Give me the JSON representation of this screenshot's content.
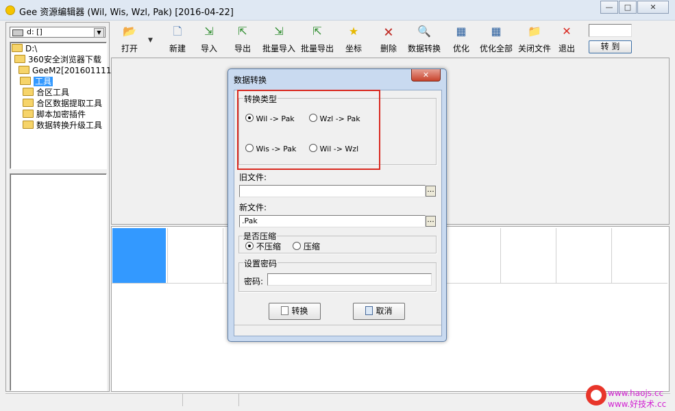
{
  "window": {
    "title": "Gee 资源编辑器 (Wil, Wis, Wzl, Pak) [2016-04-22]",
    "min": "—",
    "max": "□",
    "close": "✕"
  },
  "drive": {
    "value": "d: []"
  },
  "tree": {
    "items": [
      "D:\\",
      "360安全浏览器下载",
      "GeeM2[201601111]",
      "工具",
      "合区工具",
      "合区数据提取工具",
      "脚本加密插件",
      "数据转换升级工具"
    ]
  },
  "toolbar": {
    "buttons": [
      {
        "label": "打开",
        "icon": "open-folder-icon",
        "glyph": "📂"
      },
      {
        "label": "新建",
        "icon": "new-file-icon",
        "glyph": "🗋"
      },
      {
        "label": "导入",
        "icon": "import-icon",
        "glyph": "⇲"
      },
      {
        "label": "导出",
        "icon": "export-icon",
        "glyph": "⇱"
      },
      {
        "label": "批量导入",
        "icon": "batch-import-icon",
        "glyph": "⇲"
      },
      {
        "label": "批量导出",
        "icon": "batch-export-icon",
        "glyph": "⇱"
      },
      {
        "label": "坐标",
        "icon": "star-icon",
        "glyph": "★"
      },
      {
        "label": "删除",
        "icon": "delete-icon",
        "glyph": "🗙"
      },
      {
        "label": "数据转换",
        "icon": "convert-icon",
        "glyph": "🔍"
      },
      {
        "label": "优化",
        "icon": "optimize-icon",
        "glyph": "▦"
      },
      {
        "label": "优化全部",
        "icon": "optimize-all-icon",
        "glyph": "▦"
      },
      {
        "label": "关闭文件",
        "icon": "close-file-icon",
        "glyph": "📁"
      },
      {
        "label": "退出",
        "icon": "exit-icon",
        "glyph": "✕"
      }
    ],
    "goto_input": "",
    "goto_label": "转 到"
  },
  "dialog": {
    "title": "数据转换",
    "close": "✕",
    "type_group": "转换类型",
    "options": [
      "Wil -> Pak",
      "Wzl -> Pak",
      "Wis -> Pak",
      "Wil -> Wzl"
    ],
    "selected_option": 0,
    "old_file_label": "旧文件:",
    "old_file_value": "",
    "new_file_label": "新文件:",
    "new_file_value": ".Pak",
    "browse": "...",
    "compress_group": "是否压缩",
    "compress_options": [
      "不压缩",
      "压缩"
    ],
    "compress_selected": 0,
    "password_group": "设置密码",
    "password_label": "密码:",
    "password_value": "",
    "convert_button": "转换",
    "cancel_button": "取消"
  },
  "watermark": {
    "url": "www.haojs.cc",
    "text": "www.好技术.cc"
  },
  "colors": {
    "accent": "#3399ff",
    "highlight_box": "#d9281f"
  }
}
